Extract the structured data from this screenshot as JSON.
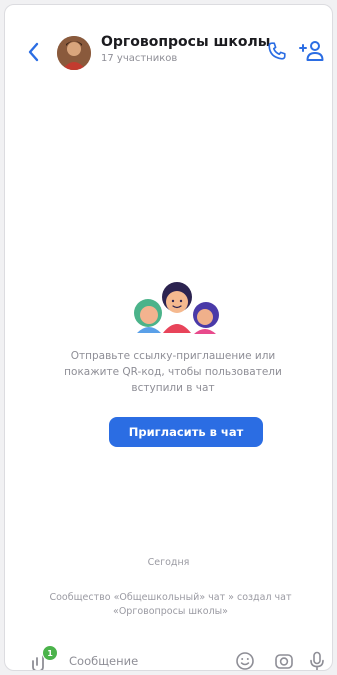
{
  "header": {
    "title": "Орговопросы школы",
    "subtitle": "17 участников"
  },
  "empty_state": {
    "invite_text": "Отправьте ссылку-приглашение или покажите QR-код, чтобы пользователи вступили в чат",
    "invite_button_label": "Пригласить в чат"
  },
  "messages": {
    "date_label": "Сегодня",
    "system_message": "Сообщество «Общешкольный» чат » создал чат «Орговопросы школы»"
  },
  "input_bar": {
    "placeholder": "Сообщение",
    "attach_badge_count": "1"
  },
  "colors": {
    "accent": "#2b6de3",
    "badge": "#4bb34b",
    "secondary_text": "#8e8e96"
  },
  "icons": {
    "back": "chevron-left-icon",
    "call": "phone-icon",
    "add_user": "add-user-icon",
    "attach": "attach-icon",
    "sticker": "smile-icon",
    "camera": "camera-icon",
    "mic": "mic-icon"
  }
}
